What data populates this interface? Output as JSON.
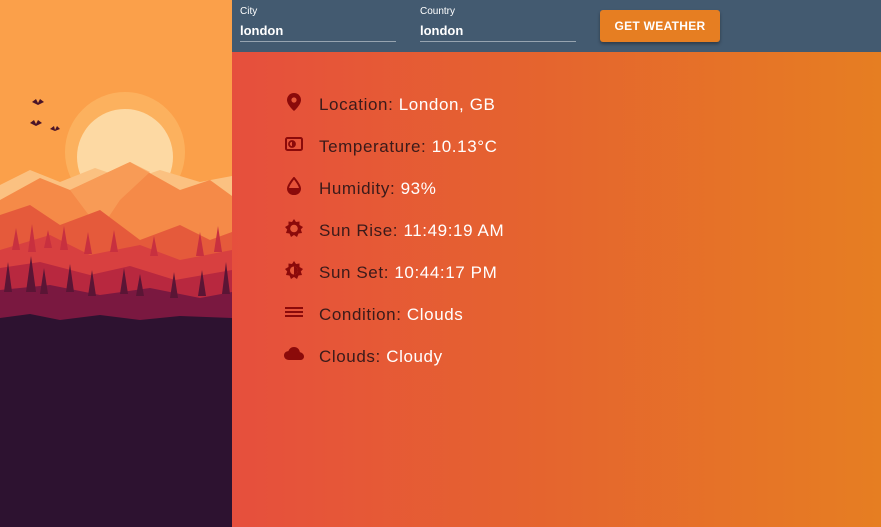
{
  "colors": {
    "topbar_bg": "#435a70",
    "button_bg": "#e67e22",
    "content_gradient_start": "#e64f3d",
    "content_gradient_end": "#e67e22",
    "icon_color": "#8b0a0a",
    "label_color": "#3a1a1a",
    "value_color": "#ffffff"
  },
  "form": {
    "city_label": "City",
    "city_value": "london",
    "country_label": "Country",
    "country_value": "london",
    "button_label": "GET WEATHER"
  },
  "weather": {
    "rows": [
      {
        "icon": "location-pin-icon",
        "label": "Location",
        "value": "London, GB"
      },
      {
        "icon": "thermometer-icon",
        "label": "Temperature",
        "value": "10.13°C"
      },
      {
        "icon": "droplet-icon",
        "label": "Humidity",
        "value": "93%"
      },
      {
        "icon": "sun-icon",
        "label": "Sun Rise",
        "value": "11:49:19 AM"
      },
      {
        "icon": "sun-half-icon",
        "label": "Sun Set",
        "value": "10:44:17 PM"
      },
      {
        "icon": "lines-icon",
        "label": "Condition",
        "value": "Clouds"
      },
      {
        "icon": "cloud-icon",
        "label": "Clouds",
        "value": "Cloudy"
      }
    ]
  }
}
